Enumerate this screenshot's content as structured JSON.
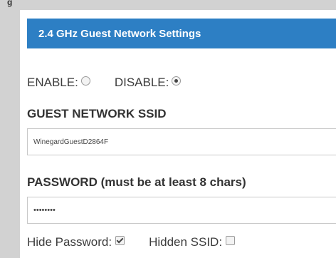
{
  "top_fragment": "g",
  "header": {
    "title": "2.4 GHz Guest Network Settings"
  },
  "enable_disable": {
    "enable_label": "ENABLE:",
    "enable_checked": false,
    "disable_label": "DISABLE:",
    "disable_checked": true
  },
  "ssid": {
    "label": "GUEST NETWORK SSID",
    "value": "WinegardGuestD2864F"
  },
  "password": {
    "label": "PASSWORD (must be at least 8 chars)",
    "value": "••••••••"
  },
  "options": {
    "hide_password_label": "Hide Password:",
    "hide_password_checked": true,
    "hidden_ssid_label": "Hidden SSID:",
    "hidden_ssid_checked": false
  },
  "colors": {
    "header_bg": "#2d7fc4",
    "page_bg": "#d2d2d2",
    "panel_bg": "#ffffff"
  }
}
